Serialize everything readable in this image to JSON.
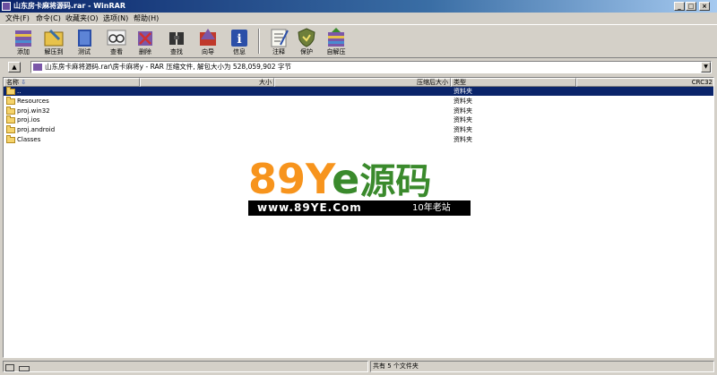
{
  "window": {
    "title": "山东房卡麻将源码.rar - WinRAR"
  },
  "menu": {
    "items": [
      {
        "label": "文件(F)"
      },
      {
        "label": "命令(C)"
      },
      {
        "label": "收藏夹(O)"
      },
      {
        "label": "选项(N)"
      },
      {
        "label": "帮助(H)"
      }
    ]
  },
  "toolbar": {
    "buttons": [
      {
        "label": "添加"
      },
      {
        "label": "解压到"
      },
      {
        "label": "测试"
      },
      {
        "label": "查看"
      },
      {
        "label": "删除"
      },
      {
        "label": "查找"
      },
      {
        "label": "向导"
      },
      {
        "label": "信息"
      },
      {
        "label": "注释"
      },
      {
        "label": "保护"
      },
      {
        "label": "自解压"
      }
    ]
  },
  "address": {
    "text": "山东房卡麻将源码.rar\\房卡麻将y - RAR 压缩文件, 解包大小为 528,059,902 字节"
  },
  "columns": {
    "name": "名称",
    "size": "大小",
    "packed": "压缩后大小",
    "type": "类型",
    "crc": "CRC32"
  },
  "files": [
    {
      "name": "..",
      "type": "资料夹",
      "selected": true
    },
    {
      "name": "Resources",
      "type": "资料夹"
    },
    {
      "name": "proj.win32",
      "type": "资料夹"
    },
    {
      "name": "proj.ios",
      "type": "资料夹"
    },
    {
      "name": "proj.android",
      "type": "资料夹"
    },
    {
      "name": "Classes",
      "type": "资料夹"
    }
  ],
  "watermark": {
    "part1": "89",
    "part2": "Y",
    "part3": "e",
    "part4": "源码",
    "url": "www.89YE.Com",
    "slogan": "10年老站"
  },
  "status": {
    "summary": "共有 5 个文件夹"
  },
  "colors": {
    "title_start": "#0a246a",
    "selection": "#0a246a",
    "watermark_orange": "#f7941d",
    "watermark_green": "#3a8a2c"
  }
}
